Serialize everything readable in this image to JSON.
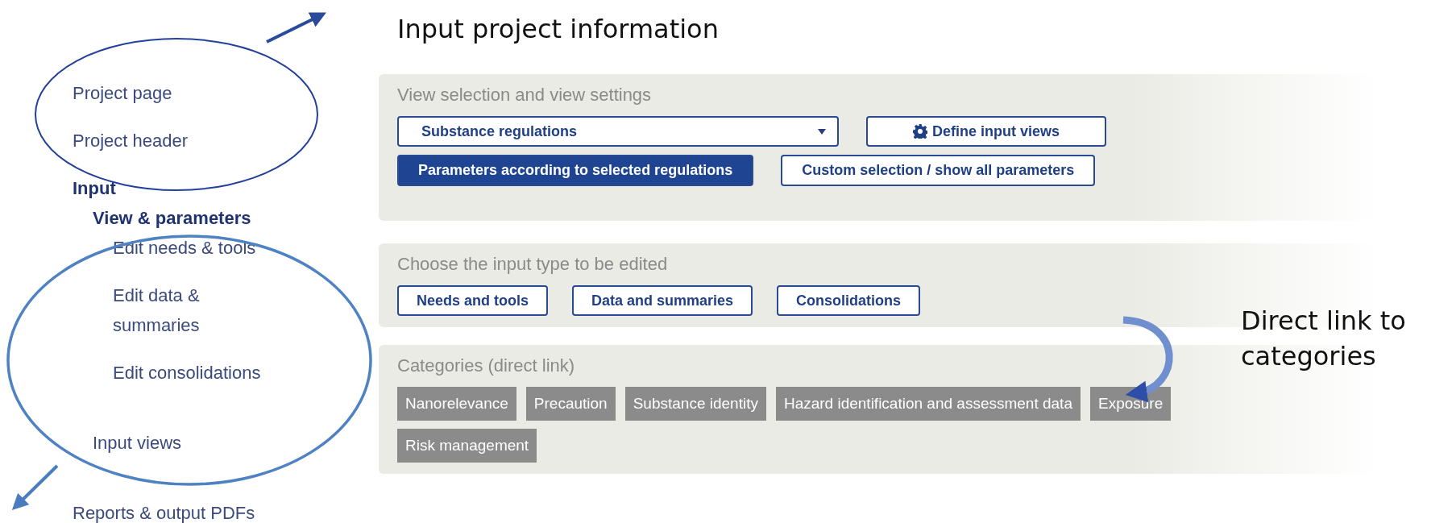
{
  "callouts": [
    {
      "kind": "top",
      "text": "Input project information"
    },
    {
      "kind": "side",
      "text": "Direct link to categories"
    }
  ],
  "sidebar": {
    "items": [
      {
        "label": "Project page",
        "selected": false
      },
      {
        "label": "Project header",
        "selected": false
      },
      {
        "label": "Input",
        "selected": true,
        "children": [
          {
            "label": "View & parameters",
            "selected": true,
            "children": [
              {
                "label": "Edit needs & tools",
                "selected": false
              },
              {
                "label": "Edit data &\nsummaries",
                "selected": false
              },
              {
                "label": "Edit consolidations",
                "selected": false
              }
            ]
          },
          {
            "label": "Input views",
            "selected": false
          }
        ]
      },
      {
        "label": "Reports & output PDFs",
        "selected": false
      }
    ]
  },
  "view_panel": {
    "title": "View selection and view settings",
    "dropdown": {
      "value": "Substance regulations"
    },
    "define_button": "Define input views",
    "modes": [
      {
        "label": "Parameters according to selected regulations",
        "selected": true
      },
      {
        "label": "Custom selection / show all parameters",
        "selected": false
      }
    ]
  },
  "input_type_panel": {
    "title": "Choose the input type to be edited",
    "buttons": [
      "Needs and tools",
      "Data and summaries",
      "Consolidations"
    ]
  },
  "categories_panel": {
    "title": "Categories (direct link)",
    "tags": [
      "Nanorelevance",
      "Precaution",
      "Substance identity",
      "Hazard identification and assessment data",
      "Exposure",
      "Risk management"
    ]
  }
}
